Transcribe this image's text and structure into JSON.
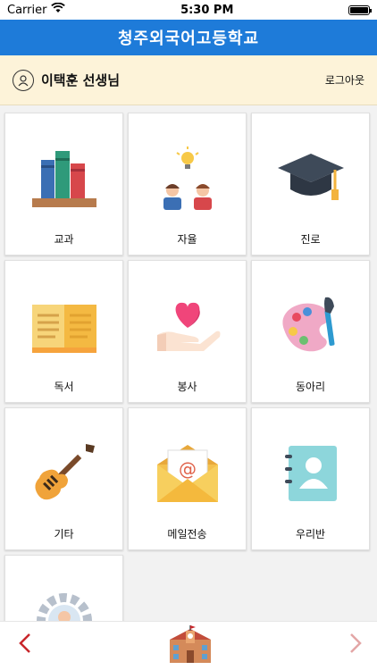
{
  "status": {
    "carrier": "Carrier",
    "time": "5:30 PM"
  },
  "header": {
    "title": "청주외국어고등학교"
  },
  "user": {
    "name": "이택훈 선생님",
    "logout_label": "로그아웃"
  },
  "menu": [
    {
      "label": "교과",
      "icon": "books-icon"
    },
    {
      "label": "자율",
      "icon": "idea-people-icon"
    },
    {
      "label": "진로",
      "icon": "graduation-cap-icon"
    },
    {
      "label": "독서",
      "icon": "open-book-icon"
    },
    {
      "label": "봉사",
      "icon": "heart-hand-icon"
    },
    {
      "label": "동아리",
      "icon": "palette-icon"
    },
    {
      "label": "기타",
      "icon": "guitar-icon"
    },
    {
      "label": "메일전송",
      "icon": "mail-icon"
    },
    {
      "label": "우리반",
      "icon": "contact-book-icon"
    },
    {
      "label": "",
      "icon": "settings-user-icon"
    }
  ],
  "footer": {
    "prev_icon": "chevron-left-icon",
    "home_icon": "school-icon",
    "next_icon": "chevron-right-icon"
  }
}
